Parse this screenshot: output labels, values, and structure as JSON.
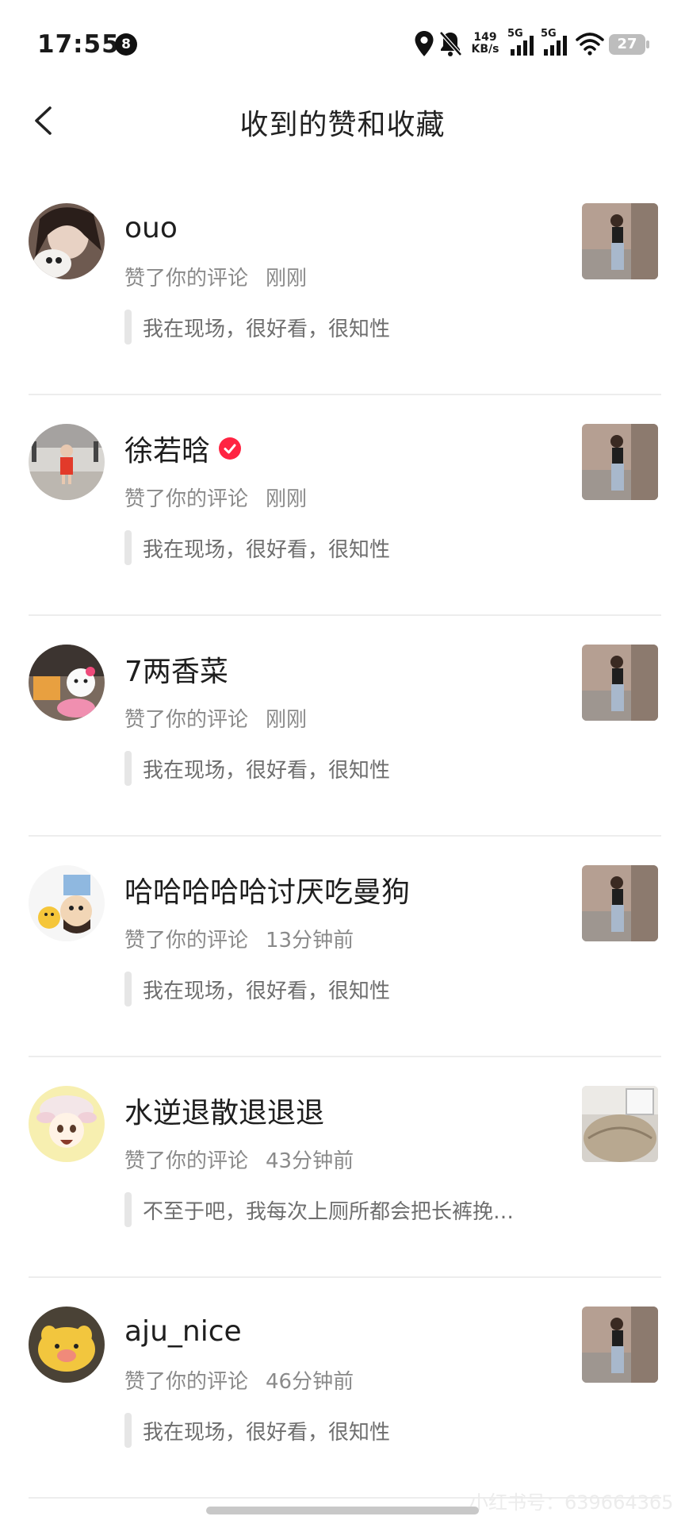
{
  "status_bar": {
    "time": "17:55",
    "notification_count": "8",
    "net_speed_value": "149",
    "net_speed_unit": "KB/s",
    "signal1_label": "5G",
    "signal2_label": "5G",
    "battery": "27",
    "icons": [
      "location-icon",
      "bell-off-icon",
      "signal-icon",
      "signal-icon",
      "wifi-icon",
      "battery-icon"
    ]
  },
  "header": {
    "back_icon": "chevron-left-icon",
    "title": "收到的赞和收藏"
  },
  "notifications": [
    {
      "username": "ouo",
      "verified": false,
      "action": "赞了你的评论",
      "time": "刚刚",
      "comment": "我在现场，很好看，很知性"
    },
    {
      "username": "徐若晗",
      "verified": true,
      "action": "赞了你的评论",
      "time": "刚刚",
      "comment": "我在现场，很好看，很知性"
    },
    {
      "username": "7两香菜",
      "verified": false,
      "action": "赞了你的评论",
      "time": "刚刚",
      "comment": "我在现场，很好看，很知性"
    },
    {
      "username": "哈哈哈哈哈讨厌吃曼狗",
      "verified": false,
      "action": "赞了你的评论",
      "time": "13分钟前",
      "comment": "我在现场，很好看，很知性"
    },
    {
      "username": "水逆退散退退退",
      "verified": false,
      "action": "赞了你的评论",
      "time": "43分钟前",
      "comment": "不至于吧，我每次上厕所都会把长裤挽…"
    },
    {
      "username": "aju_nice",
      "verified": false,
      "action": "赞了你的评论",
      "time": "46分钟前",
      "comment": "我在现场，很好看，很知性"
    }
  ],
  "watermark": "小红书号：639664365",
  "colors": {
    "accent": "#ff2442",
    "muted": "#8a8a8a",
    "quote_bar": "#e6e6e6"
  }
}
